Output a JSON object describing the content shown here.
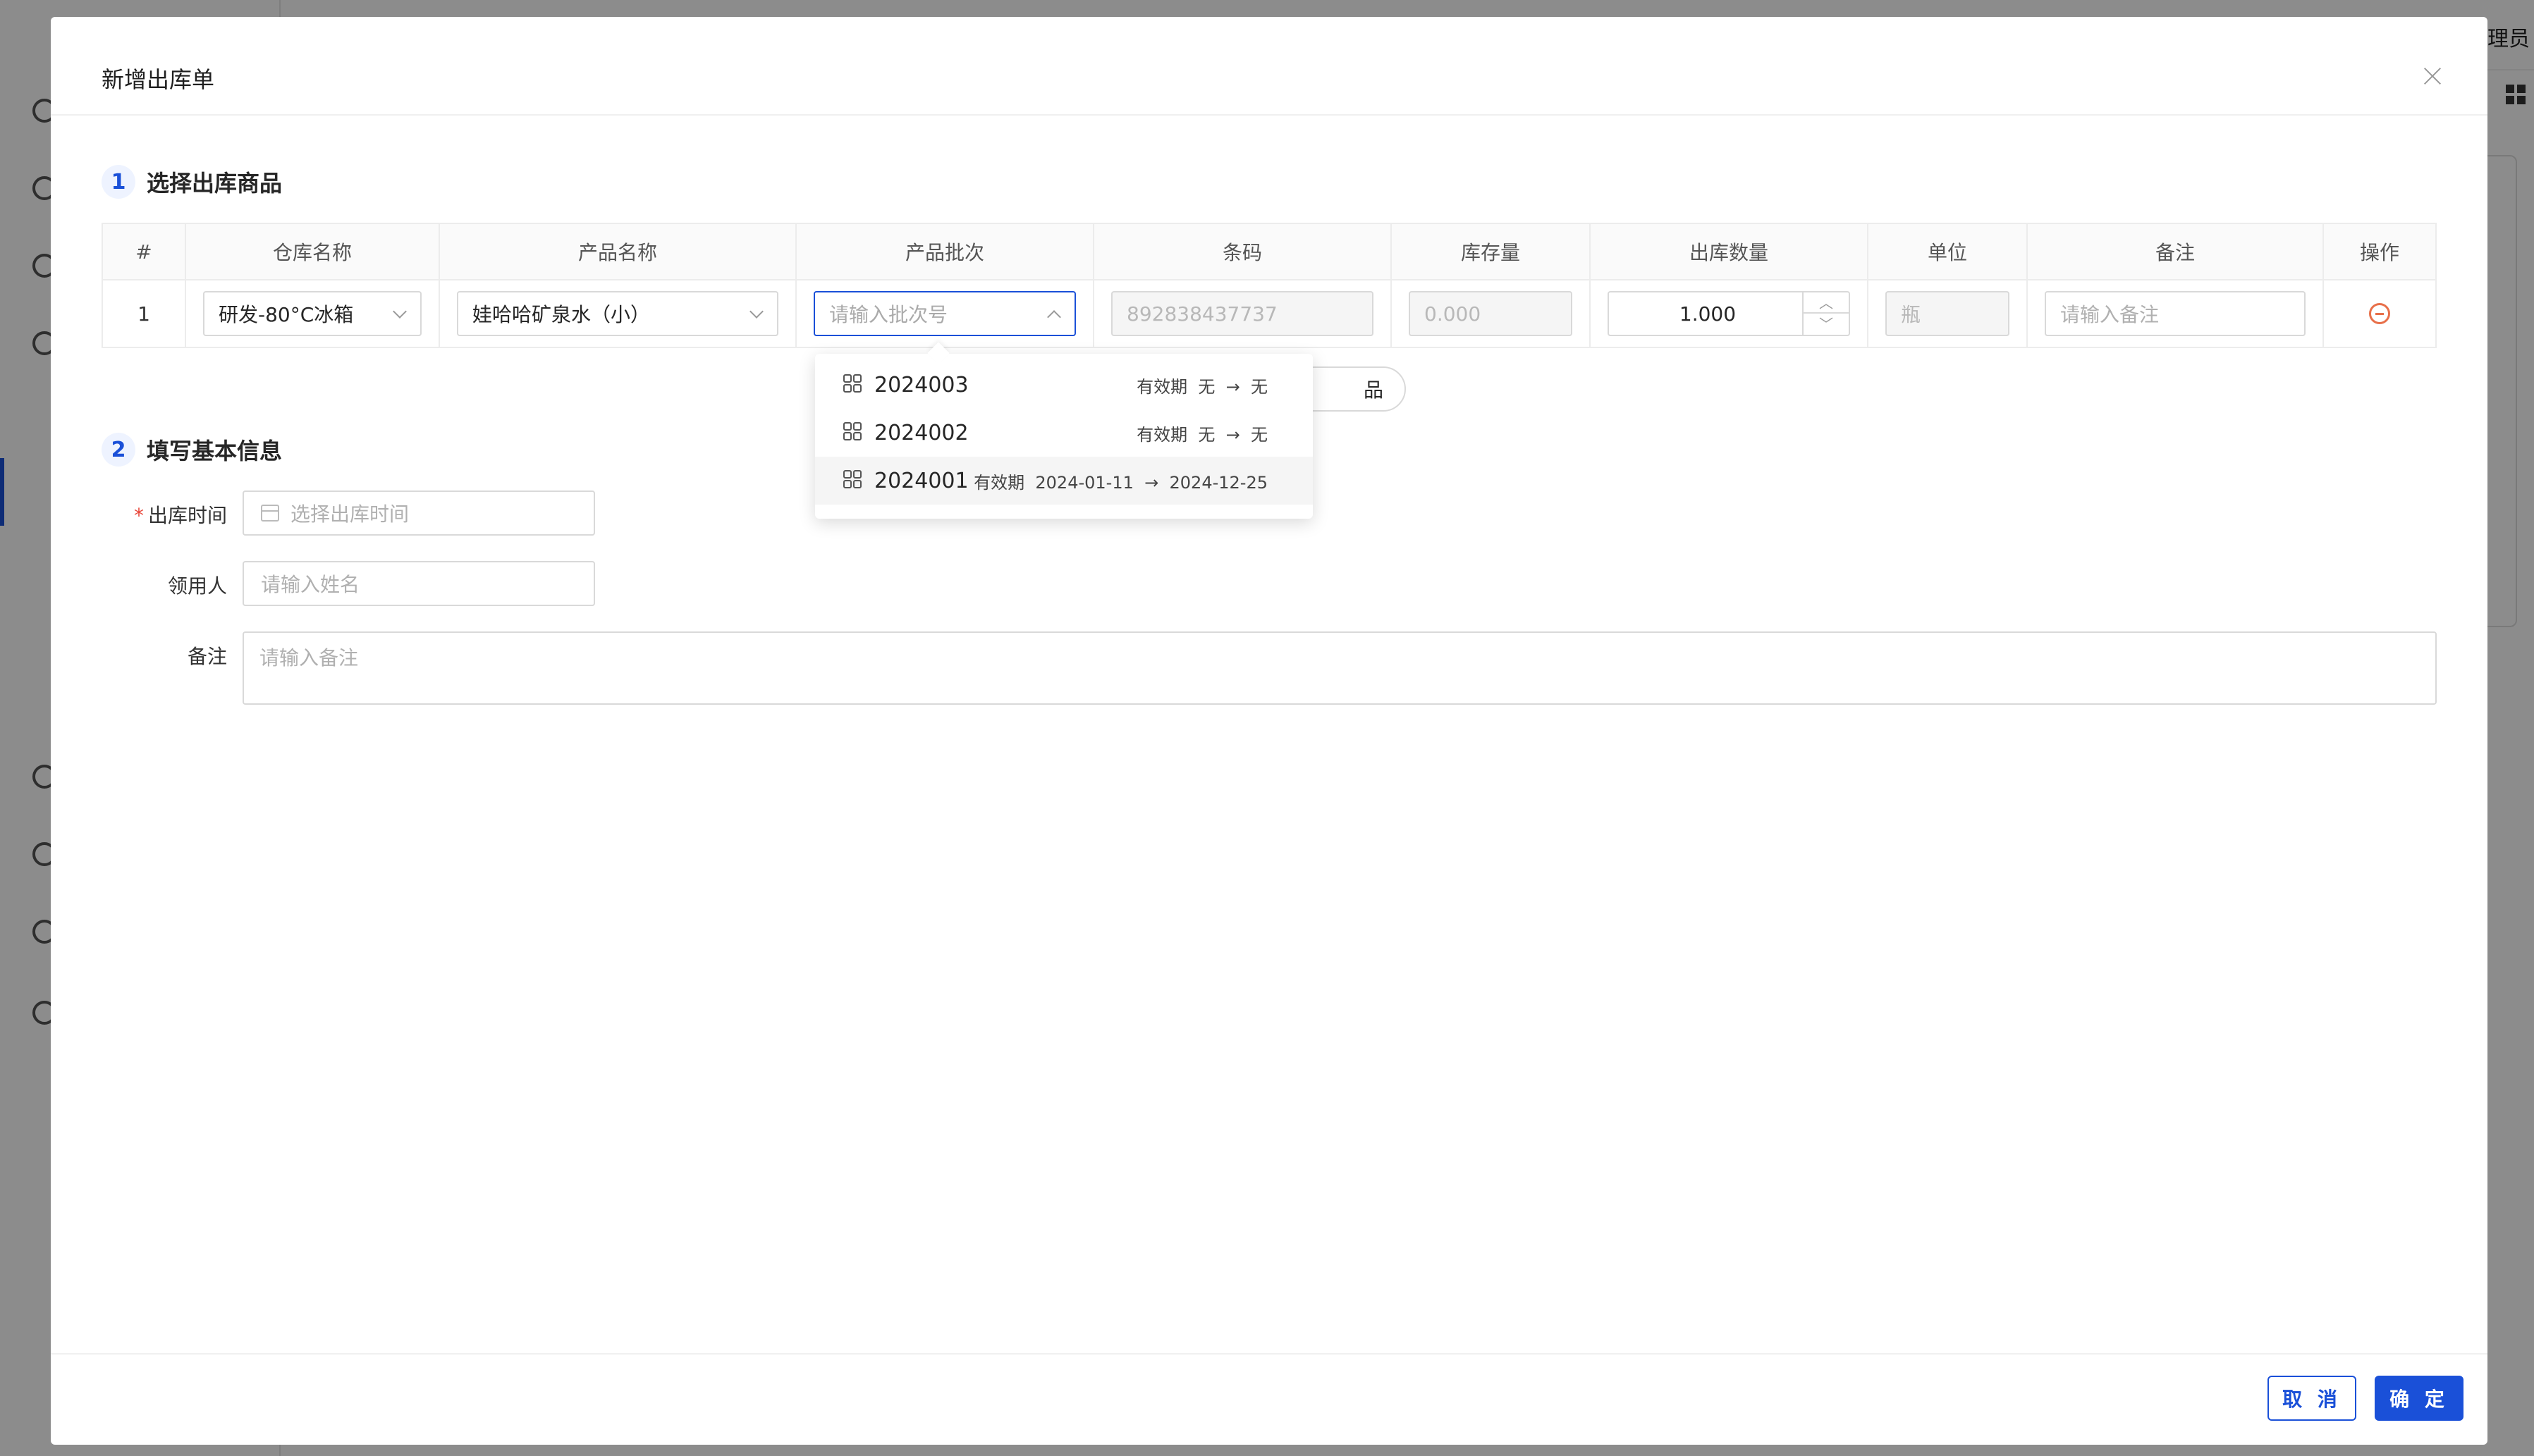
{
  "background": {
    "user_label": "理员"
  },
  "modal": {
    "title": "新增出库单",
    "step1": {
      "num": "1",
      "title": "选择出库商品"
    },
    "step2": {
      "num": "2",
      "title": "填写基本信息"
    }
  },
  "table": {
    "headers": [
      "#",
      "仓库名称",
      "产品名称",
      "产品批次",
      "条码",
      "库存量",
      "出库数量",
      "单位",
      "备注",
      "操作"
    ],
    "row": {
      "index": "1",
      "warehouse": "研发-80°C冰箱",
      "product": "娃哈哈矿泉水（小）",
      "batch_placeholder": "请输入批次号",
      "barcode": "892838437737",
      "stock": "0.000",
      "quantity": "1.000",
      "unit": "瓶",
      "remark_placeholder": "请输入备注"
    }
  },
  "batch_dropdown": {
    "items": [
      {
        "code": "2024003",
        "expiry_label": "有效期",
        "from": "无",
        "to": "无"
      },
      {
        "code": "2024002",
        "expiry_label": "有效期",
        "from": "无",
        "to": "无"
      },
      {
        "code": "2024001",
        "expiry_label": "有效期",
        "from": "2024-01-11",
        "to": "2024-12-25"
      }
    ],
    "arrow": "→"
  },
  "add_product_peek": "品",
  "form": {
    "out_time_label": "出库时间",
    "out_time_placeholder": "选择出库时间",
    "receiver_label": "领用人",
    "receiver_placeholder": "请输入姓名",
    "remark_label": "备注",
    "remark_placeholder": "请输入备注"
  },
  "footer": {
    "cancel": "取 消",
    "ok": "确 定"
  },
  "colors": {
    "primary": "#1a50d8",
    "danger": "#e8704a",
    "required": "#e8463a"
  }
}
